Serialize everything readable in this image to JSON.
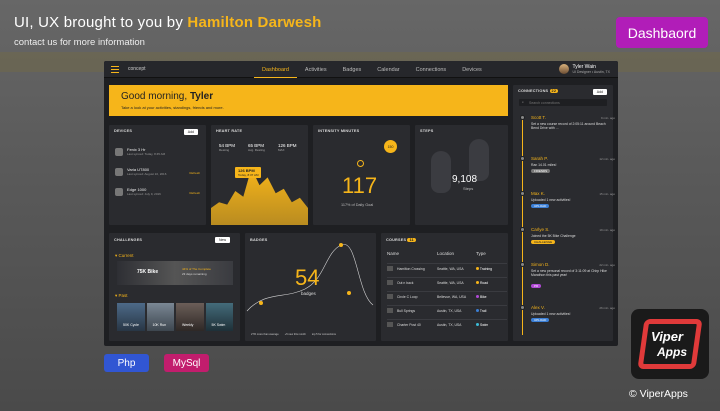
{
  "promo": {
    "title_prefix": "UI, UX brought to you by ",
    "title_name": "Hamilton Darwesh",
    "subtitle": "contact us for more information",
    "badge": "Dashbaord",
    "tags": [
      "Php",
      "MySql"
    ],
    "logo_line1": "Viper",
    "logo_line2": "Apps",
    "credit": "© ViperApps"
  },
  "app": {
    "brand": "concept",
    "nav": [
      "Dashboard",
      "Activities",
      "Badges",
      "Calendar",
      "Connections",
      "Devices"
    ],
    "active_nav": "Dashboard",
    "user": {
      "name": "Tyler Wain",
      "role": "UI Designer • Austin, TX"
    },
    "hero": {
      "greeting": "Good morning, ",
      "name": "Tyler",
      "subtitle": "Take a look at your activities, standings, friends and more."
    },
    "devices": {
      "title": "DEVICES",
      "add": "Add",
      "items": [
        {
          "name": "Fenix 3 Hr",
          "sync": "Last synced: Today, 8:45 AM",
          "status": ""
        },
        {
          "name": "Varia UT800",
          "sync": "Last synced: August 10, 2016",
          "status": "Refresh"
        },
        {
          "name": "Edge 1000",
          "sync": "Last synced: July 9, 2016",
          "status": "Refresh"
        }
      ]
    },
    "heart_rate": {
      "title": "HEART RATE",
      "stats": [
        {
          "value": "54 BPM",
          "label": "Resting"
        },
        {
          "value": "65 BPM",
          "label": "Avg. Resting"
        },
        {
          "value": "126 BPM",
          "label": "MAX"
        }
      ],
      "tooltip_value": "126 BPM",
      "tooltip_time": "Today, 8:37 AM",
      "chart_points": [
        55,
        60,
        58,
        70,
        65,
        90,
        75,
        82,
        68,
        72,
        60,
        64,
        55
      ]
    },
    "intensity": {
      "title": "INTENSITY MINUTES",
      "value": "117",
      "caption": "117% of Daily Goal",
      "badge": "150"
    },
    "steps": {
      "title": "STEPS",
      "value": "9,108",
      "caption": "Steps"
    },
    "connections": {
      "title": "CONNECTIONS",
      "count": "22",
      "add": "Add",
      "search_placeholder": "Search connections",
      "items": [
        {
          "name": "Scott T.",
          "time": "9 min. ago",
          "text": "Set a new course record of 2:05:11 around Beach Bend Drive with ...",
          "chip": "",
          "chip_color": ""
        },
        {
          "name": "Sarah P.",
          "time": "12 min. ago",
          "text": "Ran 14.01 miles!",
          "chip": "FRIENDS",
          "chip_color": "#888888"
        },
        {
          "name": "Max K.",
          "time": "15 min. ago",
          "text": "Uploaded 1 new activities!",
          "chip": "UPLOAD",
          "chip_color": "#3b7fd6"
        },
        {
          "name": "Carlye S.",
          "time": "19 min. ago",
          "text": "Joined the 5K Bike Challenge",
          "chip": "CHALLENGE",
          "chip_color": "#f6b51a"
        },
        {
          "name": "Simon D.",
          "time": "22 min. ago",
          "text": "Set a new personal record of 3:11:09 at Chirp Hike Marathon this past year!",
          "chip": "PR",
          "chip_color": "#b14ad6"
        },
        {
          "name": "Alex V.",
          "time": "26 min. ago",
          "text": "Uploaded 1 new activities!",
          "chip": "UPLOAD",
          "chip_color": "#3b7fd6"
        }
      ]
    },
    "challenges": {
      "title": "CHALLENGES",
      "new": "New",
      "current_label": "Current",
      "current_name": "75K Bike",
      "current_progress": "44% of The Complete",
      "current_remaining": "23 days remaining",
      "past_label": "Past",
      "past": [
        "50K Cycle",
        "10K Run",
        "Weekly",
        "5K Swim"
      ]
    },
    "badges": {
      "title": "BADGES",
      "value": "54",
      "caption": "badges",
      "footer": [
        "27% more than average",
        "+5 new this month",
        "top 5 for connections"
      ]
    },
    "courses": {
      "title": "COURSES",
      "count": "11",
      "columns": [
        "Name",
        "Location",
        "Type"
      ],
      "rows": [
        {
          "name": "Hamilton Crossing",
          "location": "Seattle, WA, USA",
          "type": "Training",
          "color": "#f6b51a"
        },
        {
          "name": "Out n back",
          "location": "Seattle, WA, USA",
          "type": "Road",
          "color": "#f6b51a"
        },
        {
          "name": "Circle C Loop",
          "location": "Bellevue, WA, USA",
          "type": "Bike",
          "color": "#b14ad6"
        },
        {
          "name": "Bull Springs",
          "location": "Austin, TX, USA",
          "type": "Trail",
          "color": "#3b7fd6"
        },
        {
          "name": "Charter Post 40",
          "location": "Austin, TX, USA",
          "type": "Swim",
          "color": "#3bbbd6"
        }
      ]
    }
  }
}
